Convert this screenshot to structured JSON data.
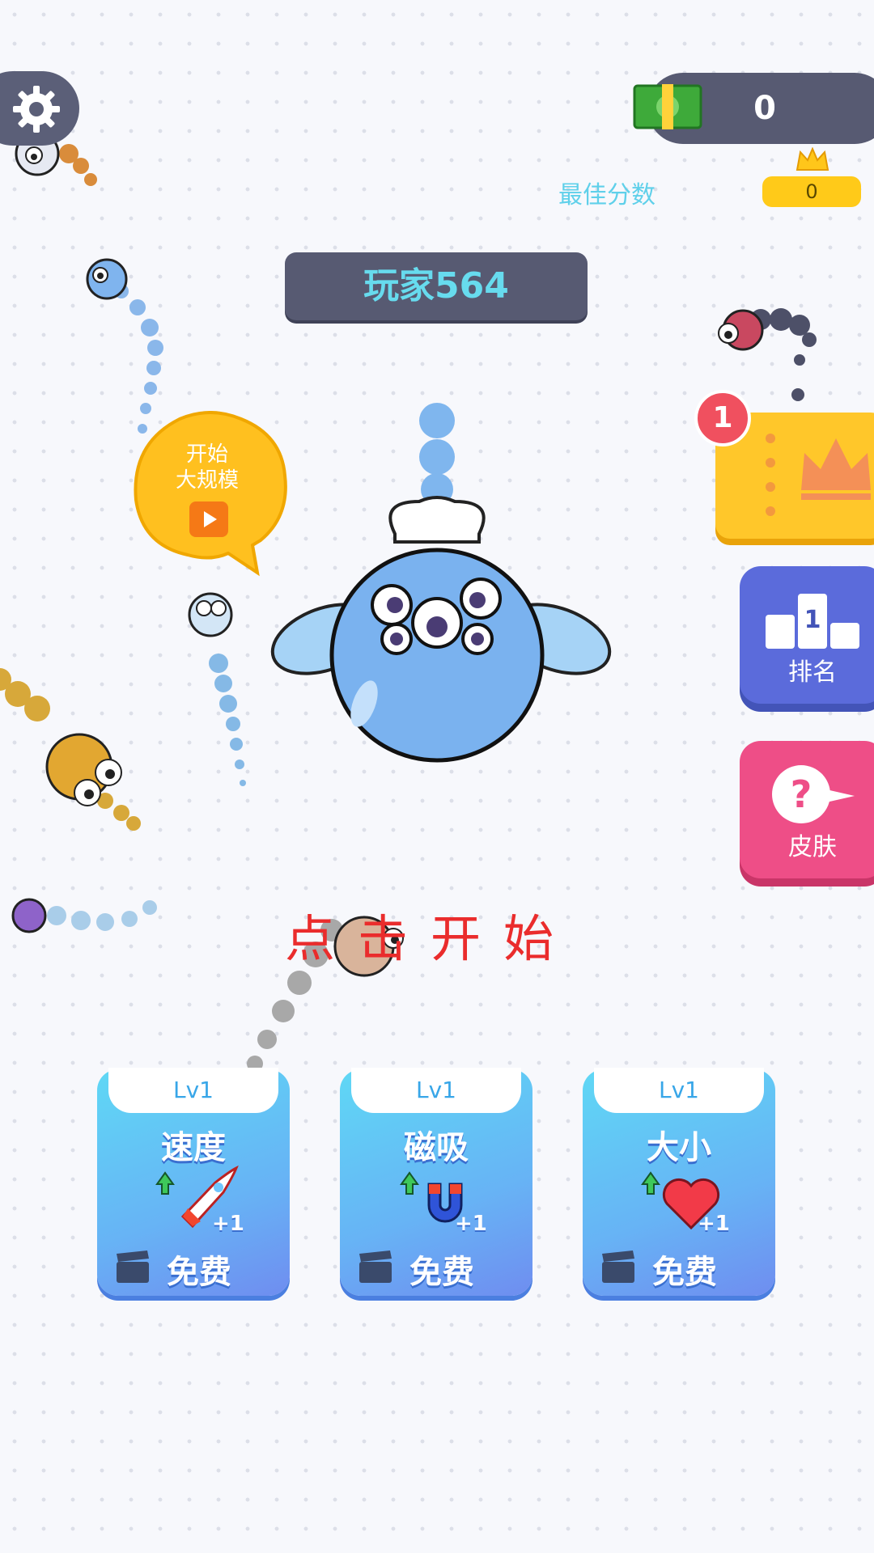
{
  "hud": {
    "currency_value": "0",
    "best_score_label": "最佳分数",
    "best_score_value": "0"
  },
  "player": {
    "name": "玩家564"
  },
  "bubble": {
    "line1": "开始",
    "line2": "大规模"
  },
  "side_buttons": {
    "vip_badge_count": "1",
    "rank_label": "排名",
    "skin_label": "皮肤"
  },
  "start_prompt": "点击开始",
  "upgrades": [
    {
      "level": "Lv1",
      "name": "速度",
      "plus": "+1",
      "action": "免费",
      "icon": "rocket-icon"
    },
    {
      "level": "Lv1",
      "name": "磁吸",
      "plus": "+1",
      "action": "免费",
      "icon": "magnet-icon"
    },
    {
      "level": "Lv1",
      "name": "大小",
      "plus": "+1",
      "action": "免费",
      "icon": "heart-icon"
    }
  ],
  "colors": {
    "panel_dark": "#575a72",
    "accent_cyan": "#67dbee",
    "start_red": "#ea2c2c",
    "rank_blue": "#5b6bdb",
    "skin_pink": "#ee4e87",
    "vip_yellow": "#ffc72a"
  }
}
